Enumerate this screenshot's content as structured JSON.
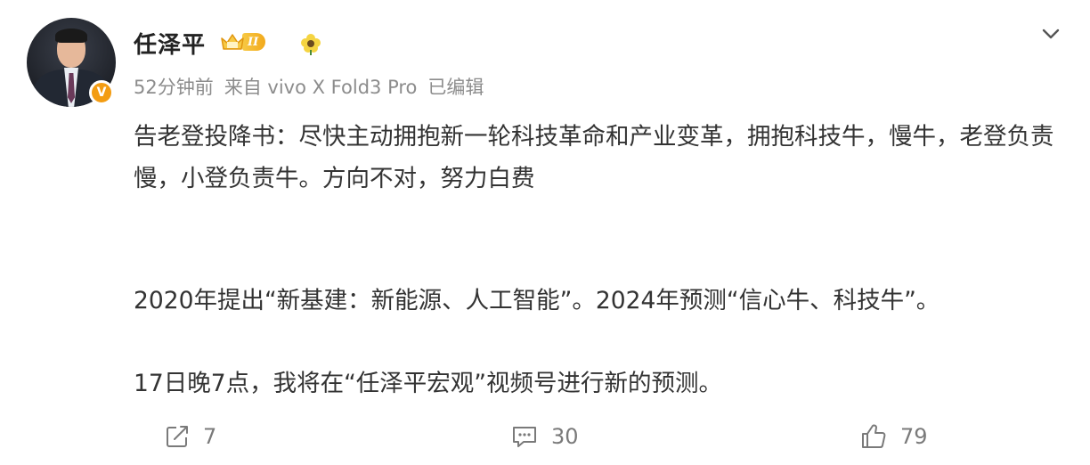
{
  "author": {
    "name": "任泽平",
    "vip_level": "II",
    "verified_mark": "V"
  },
  "meta": {
    "time": "52分钟前",
    "source": "来自 vivo X Fold3 Pro",
    "edited": "已编辑"
  },
  "content": {
    "paragraph1": "告老登投降书：尽快主动拥抱新一轮科技革命和产业变革，拥抱科技牛，慢牛，老登负责慢，小登负责牛。方向不对，努力白费",
    "paragraph2": "2020年提出“新基建：新能源、人工智能”。2024年预测“信心牛、科技牛”。",
    "paragraph3": "17日晚7点，我将在“任泽平宏观”视频号进行新的预测。"
  },
  "actions": {
    "repost_count": "7",
    "comment_count": "30",
    "like_count": "79"
  },
  "icons": {
    "repost": "repost-icon",
    "comment": "comment-icon",
    "like": "thumbs-up-icon",
    "more": "chevron-down-icon",
    "vip": "crown-icon",
    "decoration": "flower-icon"
  },
  "colors": {
    "text": "#333333",
    "meta": "#8c8c8c",
    "vip_gold": "#f2a91c",
    "verified_orange": "#f39c12"
  }
}
